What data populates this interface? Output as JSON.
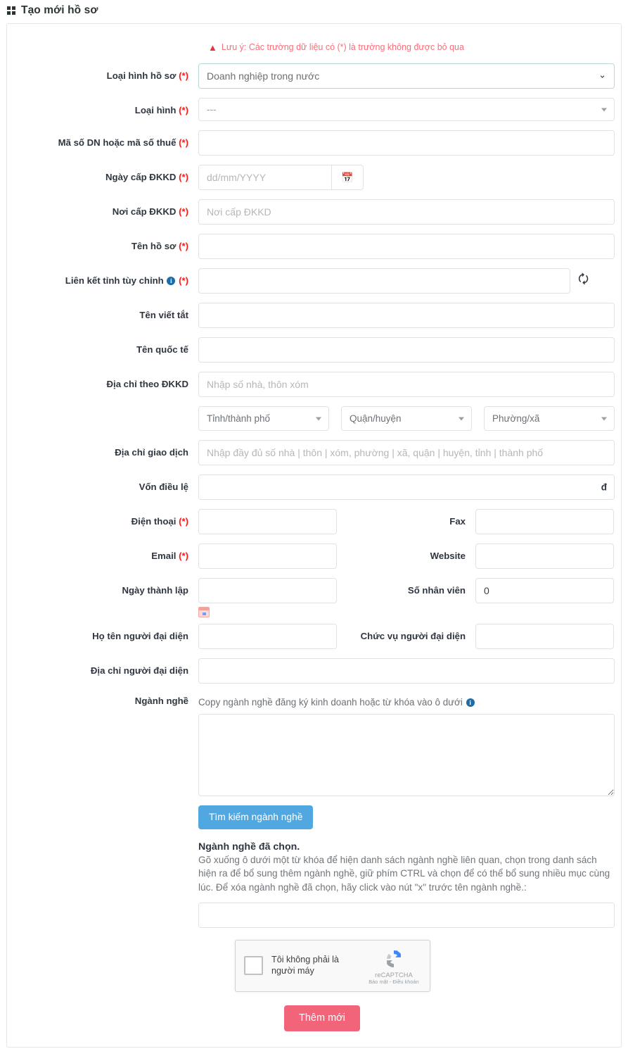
{
  "header": {
    "title": "Tạo mới hồ sơ",
    "icon": "grid-icon"
  },
  "notice": {
    "icon": "warning-triangle-icon",
    "text": "Lưu ý: Các trường dữ liệu có (*) là trường không được bỏ qua"
  },
  "form": {
    "profile_type": {
      "label": "Loại hình hồ sơ",
      "required": "(*)",
      "value": "Doanh nghiệp trong nước",
      "icon": "chevron-down-icon"
    },
    "type": {
      "label": "Loại hình",
      "required": "(*)",
      "value": "---"
    },
    "tax_code": {
      "label": "Mã số DN hoặc mã số thuế",
      "required": "(*)",
      "value": "",
      "placeholder": ""
    },
    "dkkd_date": {
      "label": "Ngày cấp ĐKKD",
      "required": "(*)",
      "placeholder": "dd/mm/YYYY",
      "value": "",
      "icon": "calendar-icon"
    },
    "dkkd_place": {
      "label": "Nơi cấp ĐKKD",
      "required": "(*)",
      "placeholder": "Nơi cấp ĐKKD",
      "value": ""
    },
    "profile_name": {
      "label": "Tên hồ sơ",
      "required": "(*)",
      "value": ""
    },
    "custom_province_link": {
      "label": "Liên kết tỉnh tùy chỉnh",
      "required": "(*)",
      "info_icon": "info-icon",
      "value": "",
      "refresh_icon": "refresh-icon"
    },
    "short_name": {
      "label": "Tên viết tắt",
      "value": ""
    },
    "international_name": {
      "label": "Tên quốc tế",
      "value": ""
    },
    "dkkd_address": {
      "label": "Địa chỉ theo ĐKKD",
      "placeholder": "Nhập số nhà, thôn xóm",
      "value": ""
    },
    "province": {
      "label": "",
      "value": "Tỉnh/thành phố"
    },
    "district": {
      "label": "",
      "value": "Quận/huyện"
    },
    "ward": {
      "label": "",
      "value": "Phường/xã"
    },
    "transaction_address": {
      "label": "Địa chỉ giao dịch",
      "placeholder": "Nhập đầy đủ số nhà | thôn | xóm, phường | xã, quận | huyện, tỉnh | thành phố",
      "value": ""
    },
    "charter_capital": {
      "label": "Vốn điều lệ",
      "value": "",
      "suffix": "đ"
    },
    "phone": {
      "label": "Điện thoại",
      "required": "(*)",
      "value": ""
    },
    "fax": {
      "label": "Fax",
      "value": ""
    },
    "email": {
      "label": "Email",
      "required": "(*)",
      "value": ""
    },
    "website": {
      "label": "Website",
      "value": ""
    },
    "founded_date": {
      "label": "Ngày thành lập",
      "value": "",
      "icon": "calendar-picker-icon"
    },
    "employees": {
      "label": "Số nhân viên",
      "value": "0"
    },
    "rep_name": {
      "label": "Họ tên người đại diện",
      "value": ""
    },
    "rep_position": {
      "label": "Chức vụ người đại diện",
      "value": ""
    },
    "rep_address": {
      "label": "Địa chỉ người đại diện",
      "value": ""
    },
    "industry": {
      "label": "Ngành nghề",
      "hint": "Copy ngành nghề đăng ký kinh doanh hoặc từ khóa vào ô dưới",
      "info_icon": "info-icon",
      "textarea_value": "",
      "search_button": "Tìm kiếm ngành nghề"
    },
    "chosen_industry": {
      "title": "Ngành nghề đã chọn.",
      "description": "Gõ xuống ô dưới một từ khóa để hiện danh sách ngành nghề liên quan, chọn trong danh sách hiện ra để bổ sung thêm ngành nghề, giữ phím CTRL và chọn để có thể bổ sung nhiều mục cùng lúc. Để xóa ngành nghề đã chọn, hãy click vào nút \"x\" trước tên ngành nghề.:",
      "value": ""
    }
  },
  "recaptcha": {
    "label": "Tôi không phải là người máy",
    "brand": "reCAPTCHA",
    "links": "Bảo mật - Điều khoản",
    "logo_icon": "recaptcha-logo-icon"
  },
  "submit": {
    "label": "Thêm mới"
  },
  "colors": {
    "accent_blue": "#51a8e0",
    "submit_pink": "#f2647a",
    "required_red": "#ff1a1a",
    "notice_red": "#f5707a"
  }
}
